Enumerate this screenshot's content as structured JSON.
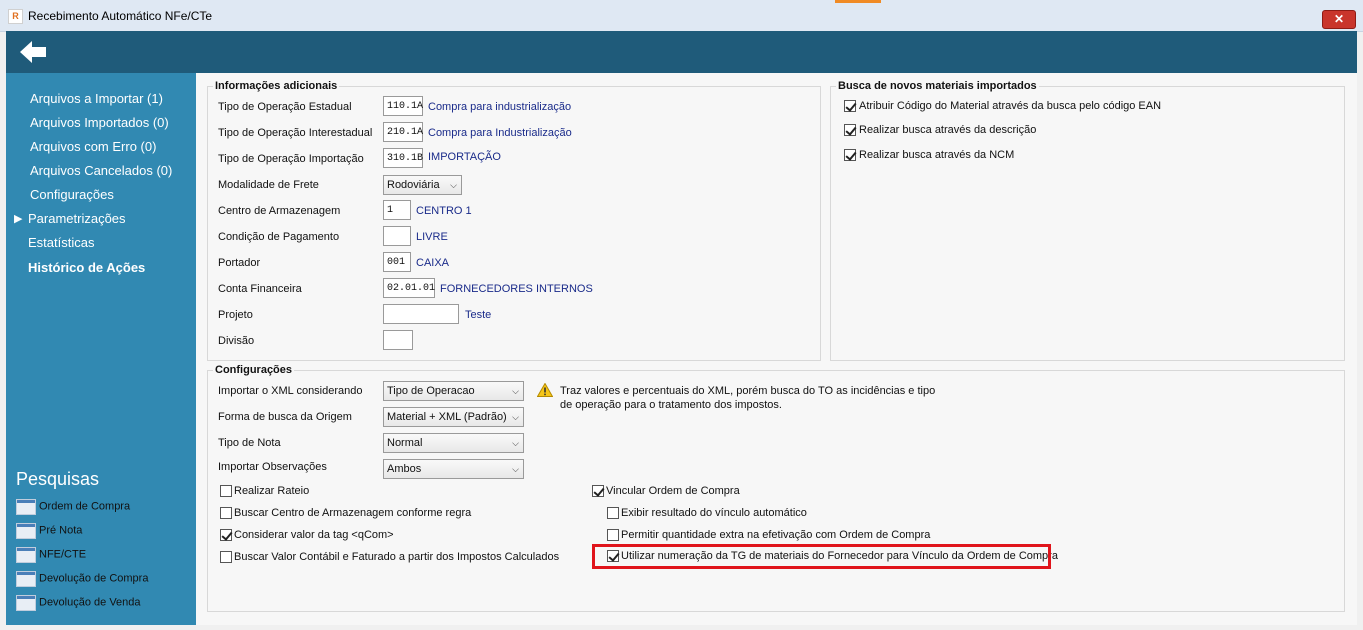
{
  "window": {
    "title": "Recebimento Automático NFe/CTe",
    "close_label": "✕",
    "app_icon_text": "R"
  },
  "sidebar": {
    "items": [
      {
        "label": "Arquivos a Importar (1)"
      },
      {
        "label": "Arquivos Importados (0)"
      },
      {
        "label": "Arquivos com Erro (0)"
      },
      {
        "label": "Arquivos Cancelados (0)"
      },
      {
        "label": "Configurações"
      },
      {
        "label": "Parametrizações"
      },
      {
        "label": "Estatísticas"
      },
      {
        "label": "Histórico de Ações"
      }
    ],
    "pesquisas_title": "Pesquisas",
    "pesquisas": [
      {
        "label": "Ordem de Compra",
        "icon": "window-icon"
      },
      {
        "label": "Pré Nota",
        "icon": "document-add-icon"
      },
      {
        "label": "NFE/CTE",
        "icon": "document-icon"
      },
      {
        "label": "Devolução de Compra",
        "icon": "return-document-icon"
      },
      {
        "label": "Devolução de Venda",
        "icon": "return-document-icon"
      }
    ]
  },
  "info": {
    "title": "Informações adicionais",
    "rows": [
      {
        "label": "Tipo de Operação Estadual",
        "code": "110.1A",
        "desc": "Compra para industrialização"
      },
      {
        "label": "Tipo de Operação Interestadual",
        "code": "210.1A",
        "desc": "Compra para Industrialização"
      },
      {
        "label": "Tipo de Operação Importação",
        "code": "310.1B",
        "desc": "IMPORTAÇÃO"
      },
      {
        "label": "Modalidade de Frete",
        "select": "Rodoviária"
      },
      {
        "label": "Centro de Armazenagem",
        "code": "1",
        "desc": "CENTRO 1"
      },
      {
        "label": "Condição de Pagamento",
        "code": "",
        "desc": "LIVRE"
      },
      {
        "label": "Portador",
        "code": "001",
        "desc": "CAIXA"
      },
      {
        "label": "Conta Financeira",
        "code": "02.01.01",
        "desc": "FORNECEDORES INTERNOS"
      },
      {
        "label": "Projeto",
        "code": "",
        "desc": "Teste"
      },
      {
        "label": "Divisão",
        "code": "",
        "desc": ""
      }
    ]
  },
  "busca": {
    "title": "Busca de novos materiais importados",
    "items": [
      {
        "label": "Atribuir Código do Material através da busca pelo código EAN",
        "checked": true
      },
      {
        "label": "Realizar busca através da descrição",
        "checked": true
      },
      {
        "label": "Realizar busca através da NCM",
        "checked": true
      }
    ]
  },
  "config": {
    "title": "Configurações",
    "rows": [
      {
        "label": "Importar o XML considerando",
        "select": "Tipo de Operacao"
      },
      {
        "label": "Forma de busca da Origem",
        "select": "Material + XML (Padrão)"
      },
      {
        "label": "Tipo de Nota",
        "select": "Normal"
      },
      {
        "label": "Importar Observações",
        "select": "Ambos"
      }
    ],
    "warning_line1": "Traz valores e percentuais do XML, porém busca do TO as incidências e tipo",
    "warning_line2": "de operação para o tratamento dos impostos.",
    "left_checks": [
      {
        "label": "Realizar Rateio",
        "checked": false
      },
      {
        "label": "Buscar Centro de Armazenagem conforme regra",
        "checked": false
      },
      {
        "label": "Considerar valor da tag <qCom>",
        "checked": true
      },
      {
        "label": "Buscar Valor Contábil e Faturado a partir dos Impostos Calculados",
        "checked": false
      }
    ],
    "vincular": {
      "label": "Vincular Ordem de Compra",
      "checked": true
    },
    "right_checks": [
      {
        "label": "Exibir resultado do vínculo automático",
        "checked": false
      },
      {
        "label": "Permitir quantidade extra na efetivação com Ordem de Compra",
        "checked": false
      },
      {
        "label": "Utilizar numeração da TG de materiais do Fornecedor para Vínculo da Ordem de Compra",
        "checked": true
      }
    ]
  },
  "colors": {
    "header": "#1f5b7a",
    "sidebar": "#3189b2",
    "highlight": "#e0141b",
    "link": "#1a2b8a"
  }
}
